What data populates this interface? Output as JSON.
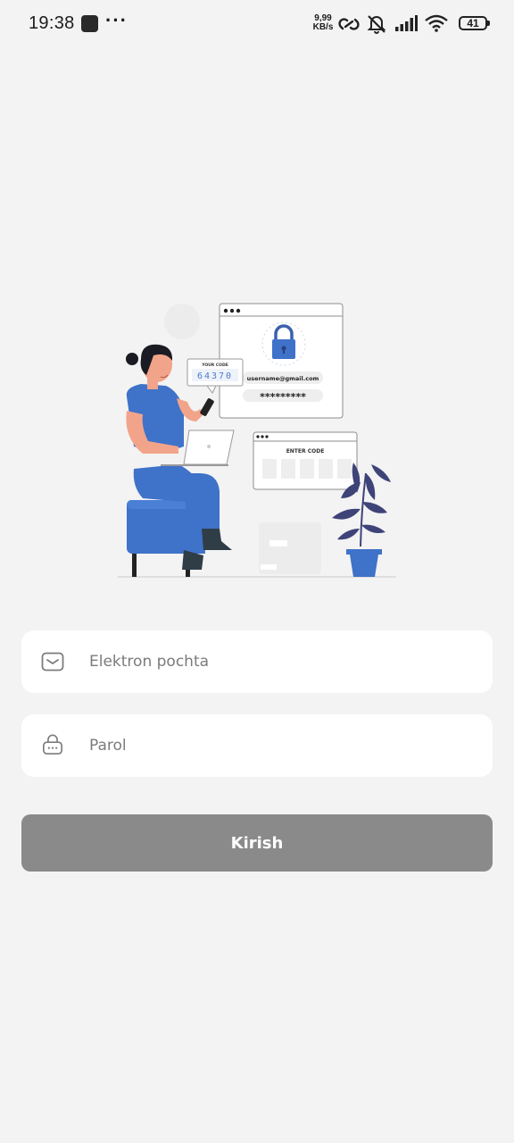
{
  "status_bar": {
    "time": "19:38",
    "network_speed": "9,99",
    "network_unit": "KB/s",
    "battery": "41"
  },
  "illustration": {
    "your_code_label": "YOUR CODE",
    "code_value": "64370",
    "username": "username@gmail.com",
    "password_mask": "*********",
    "enter_code_label": "ENTER CODE"
  },
  "form": {
    "email_placeholder": "Elektron pochta",
    "password_placeholder": "Parol",
    "submit_label": "Kirish"
  },
  "colors": {
    "background": "#f3f3f4",
    "button": "#8a8a8a",
    "accent_blue": "#3f72c9"
  }
}
